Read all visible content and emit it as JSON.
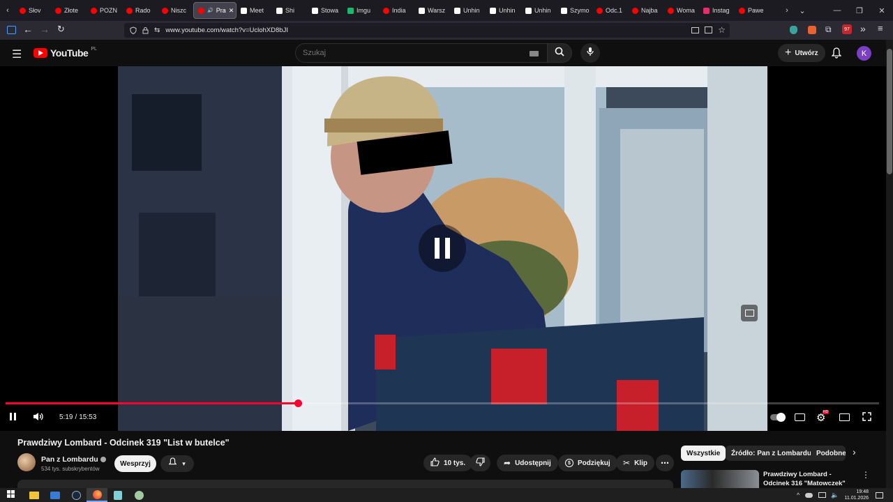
{
  "browser": {
    "tabs": [
      {
        "label": "Słov",
        "color": "#ff0000"
      },
      {
        "label": "Złote",
        "color": "#ff0000"
      },
      {
        "label": "POZN",
        "color": "#ff0000"
      },
      {
        "label": "Rado",
        "color": "#ff0000"
      },
      {
        "label": "Niszc",
        "color": "#ff0000"
      },
      {
        "label": "Pra",
        "color": "#ff0000",
        "active": true
      },
      {
        "label": "Meet",
        "color": "#ffffff"
      },
      {
        "label": "Shi",
        "color": "#ffffff"
      },
      {
        "label": "Stowa",
        "color": "#ffffff"
      },
      {
        "label": "Imgu",
        "color": "#1bb76e"
      },
      {
        "label": "India",
        "color": "#ff0000"
      },
      {
        "label": "Warsz",
        "color": "#ffffff"
      },
      {
        "label": "Unhin",
        "color": "#ffffff"
      },
      {
        "label": "Unhin",
        "color": "#ffffff"
      },
      {
        "label": "Unhin",
        "color": "#ffffff"
      },
      {
        "label": "Szymo",
        "color": "#ffffff"
      },
      {
        "label": "Odc.1",
        "color": "#ff0000"
      },
      {
        "label": "Najba",
        "color": "#ff0000"
      },
      {
        "label": "Woma",
        "color": "#ff0000"
      },
      {
        "label": "Instag",
        "color": "#e1306c"
      },
      {
        "label": "Pawe",
        "color": "#ff0000"
      }
    ],
    "url": "www.youtube.com/watch?v=UclohXD8bJI",
    "ext_badge": "97"
  },
  "youtube": {
    "logo_text": "YouTube",
    "region": "PL",
    "search_placeholder": "Szukaj",
    "create_label": "Utwórz",
    "avatar_letter": "K"
  },
  "player": {
    "current_time": "5:19",
    "separator": "/",
    "duration": "15:53",
    "progress": 0.335,
    "hd_badge": "HD"
  },
  "video": {
    "title": "Prawdziwy Lombard - Odcinek 319 \"List w butelce\"",
    "channel": "Pan z Lombardu",
    "subscribers": "534 tys. subskrybentów",
    "support_label": "Wesprzyj",
    "likes": "10 tys.",
    "share_label": "Udostępnij",
    "thanks_label": "Podziękuj",
    "clip_label": "Klip"
  },
  "sidebar": {
    "chips": [
      "Wszystkie",
      "Źródło: Pan z Lombardu",
      "Podobne"
    ],
    "rec_title": "Prawdziwy Lombard - Odcinek 316 \"Matowczek\""
  },
  "taskbar": {
    "time": "19:48",
    "date": "11.01.2026"
  }
}
